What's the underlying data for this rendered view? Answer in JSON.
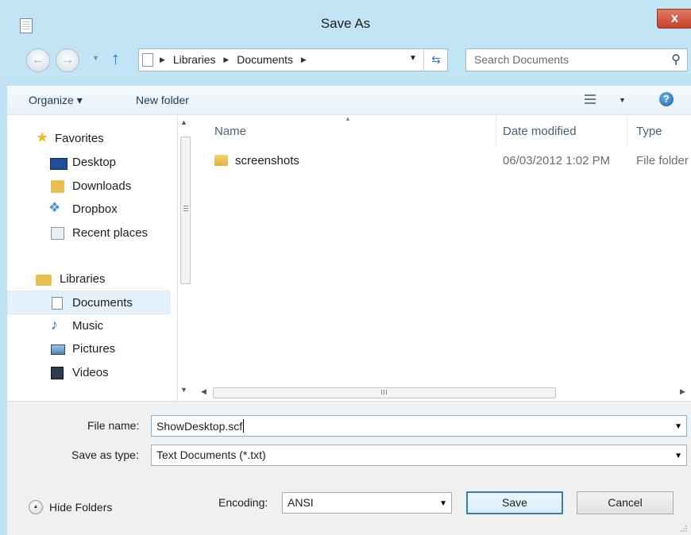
{
  "window": {
    "title": "Save As",
    "close_label": "x"
  },
  "nav": {
    "back_glyph": "←",
    "forward_glyph": "→",
    "up_glyph": "↑",
    "breadcrumbs": [
      "Libraries",
      "Documents"
    ],
    "search_placeholder": "Search Documents"
  },
  "toolbar": {
    "organize_label": "Organize ▾",
    "new_folder_label": "New folder",
    "help_glyph": "?"
  },
  "sidebar": {
    "favorites_label": "Favorites",
    "items": [
      {
        "label": "Desktop"
      },
      {
        "label": "Downloads"
      },
      {
        "label": "Dropbox"
      },
      {
        "label": "Recent places"
      }
    ],
    "libraries_label": "Libraries",
    "library_items": [
      {
        "label": "Documents",
        "selected": true
      },
      {
        "label": "Music"
      },
      {
        "label": "Pictures"
      },
      {
        "label": "Videos"
      }
    ]
  },
  "filelist": {
    "columns": [
      "Name",
      "Date modified",
      "Type"
    ],
    "rows": [
      {
        "name": "screenshots",
        "date": "06/03/2012 1:02 PM",
        "type": "File folder"
      }
    ],
    "hscroll_grip": "III"
  },
  "form": {
    "file_name_label": "File name:",
    "file_name_value": "ShowDesktop.scf",
    "save_as_type_label": "Save as type:",
    "save_as_type_value": "Text Documents (*.txt)",
    "encoding_label": "Encoding:",
    "encoding_value": "ANSI",
    "hide_folders_label": "Hide Folders",
    "save_label": "Save",
    "cancel_label": "Cancel"
  },
  "colors": {
    "chrome": "#c2e5f5",
    "close": "#c8402a",
    "accent": "#2b7cd3",
    "selection": "#e5f1fb"
  }
}
